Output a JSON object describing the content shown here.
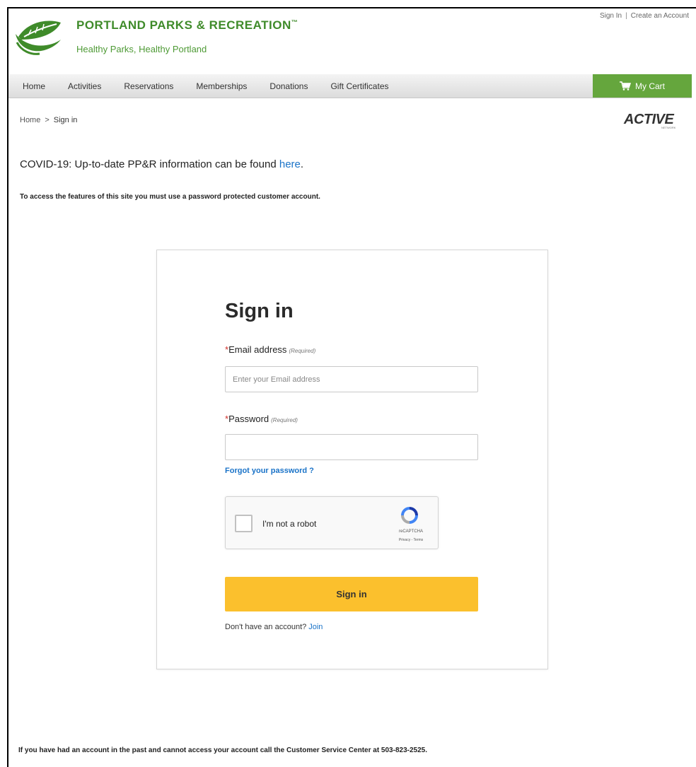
{
  "header": {
    "org_name": "PORTLAND PARKS & RECREATION",
    "trademark": "™",
    "tagline": "Healthy Parks, Healthy Portland",
    "top_links": {
      "sign_in": "Sign In",
      "separator": "|",
      "create_account": "Create an Account"
    },
    "brand_color": "#3f8b2a"
  },
  "nav": {
    "items": [
      {
        "label": "Home"
      },
      {
        "label": "Activities"
      },
      {
        "label": "Reservations"
      },
      {
        "label": "Memberships"
      },
      {
        "label": "Donations"
      },
      {
        "label": "Gift Certificates"
      }
    ],
    "cart_label": "My Cart",
    "cart_icon": "shopping-cart-icon",
    "cart_color": "#65a63d"
  },
  "breadcrumb": {
    "home": "Home",
    "separator": ">",
    "current": "Sign in"
  },
  "active_logo": {
    "text": "ACTIVE",
    "subtext": "NETWORK"
  },
  "notices": {
    "covid_text": "COVID-19: Up-to-date PP&R information can be found ",
    "covid_link": "here",
    "covid_tail": ".",
    "access_note": "To access the features of this site you must use a password protected customer account.",
    "footer_note": "If you have had an account in the past and cannot access your account call the Customer Service Center at 503-823-2525."
  },
  "signin_form": {
    "title": "Sign in",
    "email": {
      "required_mark": "*",
      "label": "Email address",
      "required_note": "(Required)",
      "placeholder": "Enter your Email address",
      "value": ""
    },
    "password": {
      "required_mark": "*",
      "label": "Password",
      "required_note": "(Required)",
      "placeholder": "",
      "value": ""
    },
    "forgot_link": "Forgot your password ?",
    "recaptcha": {
      "label": "I'm not a robot",
      "brand": "reCAPTCHA",
      "terms": "Privacy - Terms",
      "checked": false
    },
    "submit_label": "Sign in",
    "submit_color": "#fbc02d",
    "join_prompt": "Don't have an account?",
    "join_link": "Join"
  }
}
